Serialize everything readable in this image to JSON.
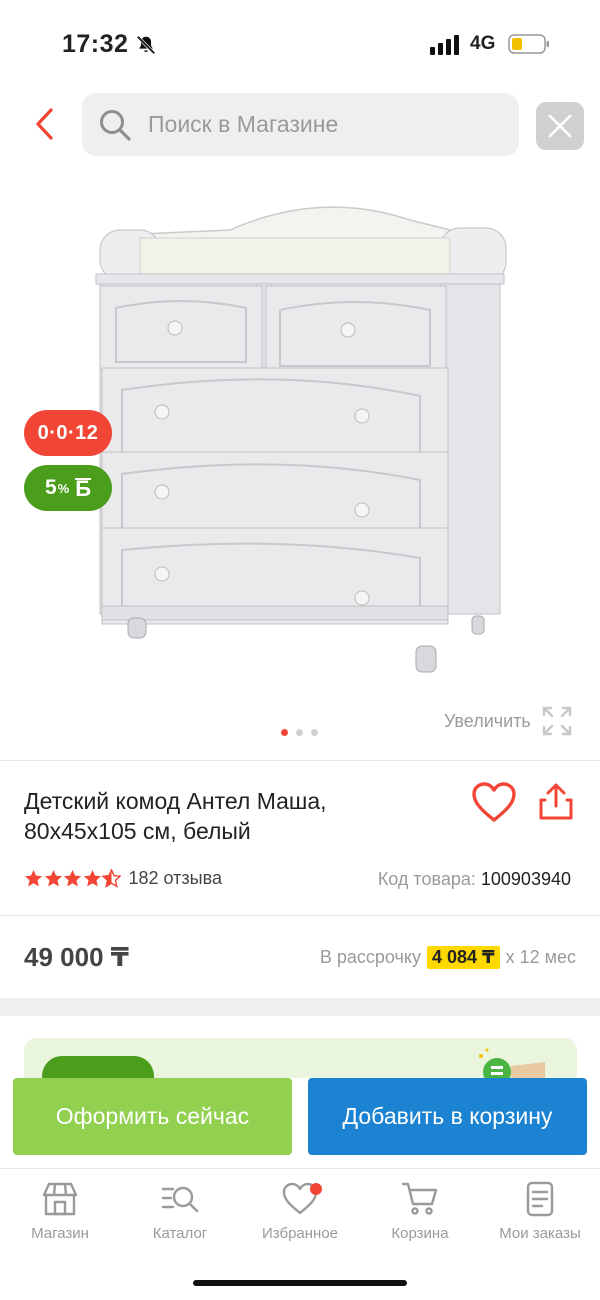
{
  "status_bar": {
    "time": "17:32",
    "network": "4G",
    "icons": [
      "bell-muted-icon",
      "signal-icon",
      "battery-icon"
    ]
  },
  "header": {
    "back_icon": "chevron-left-icon",
    "search_placeholder": "Поиск в Магазине",
    "close_icon": "close-icon"
  },
  "gallery": {
    "image_alt": "white-dresser-image",
    "badge_installment": "0·0·12",
    "badge_bonus_percent": "5",
    "badge_bonus_percent_sign": "%",
    "badge_bonus_currency": "Б",
    "zoom_label": "Увеличить",
    "dots_count": 3,
    "active_dot": 0
  },
  "product": {
    "title": "Детский комод Антел Маша, 80x45x105 см, белый",
    "rating": 4.5,
    "reviews": "182 отзыва",
    "sku_label": "Код товара:",
    "sku_value": "100903940",
    "price": "49 000 ₸",
    "installment_label": "В рассрочку",
    "installment_amount": "4 084 ₸",
    "installment_term": "x 12 мес"
  },
  "actions": {
    "buy_now": "Оформить сейчас",
    "add_to_cart": "Добавить в корзину"
  },
  "tabbar": {
    "items": [
      {
        "label": "Магазин",
        "icon": "store-icon"
      },
      {
        "label": "Каталог",
        "icon": "catalog-search-icon"
      },
      {
        "label": "Избранное",
        "icon": "heart-icon",
        "has_badge": true
      },
      {
        "label": "Корзина",
        "icon": "cart-icon"
      },
      {
        "label": "Мои заказы",
        "icon": "orders-icon"
      }
    ]
  },
  "colors": {
    "accent_red": "#f14635",
    "green_button": "#92d050",
    "blue_button": "#1b83d2",
    "bonus_green": "#4b9d1c",
    "installment_yellow": "#ffd800"
  }
}
